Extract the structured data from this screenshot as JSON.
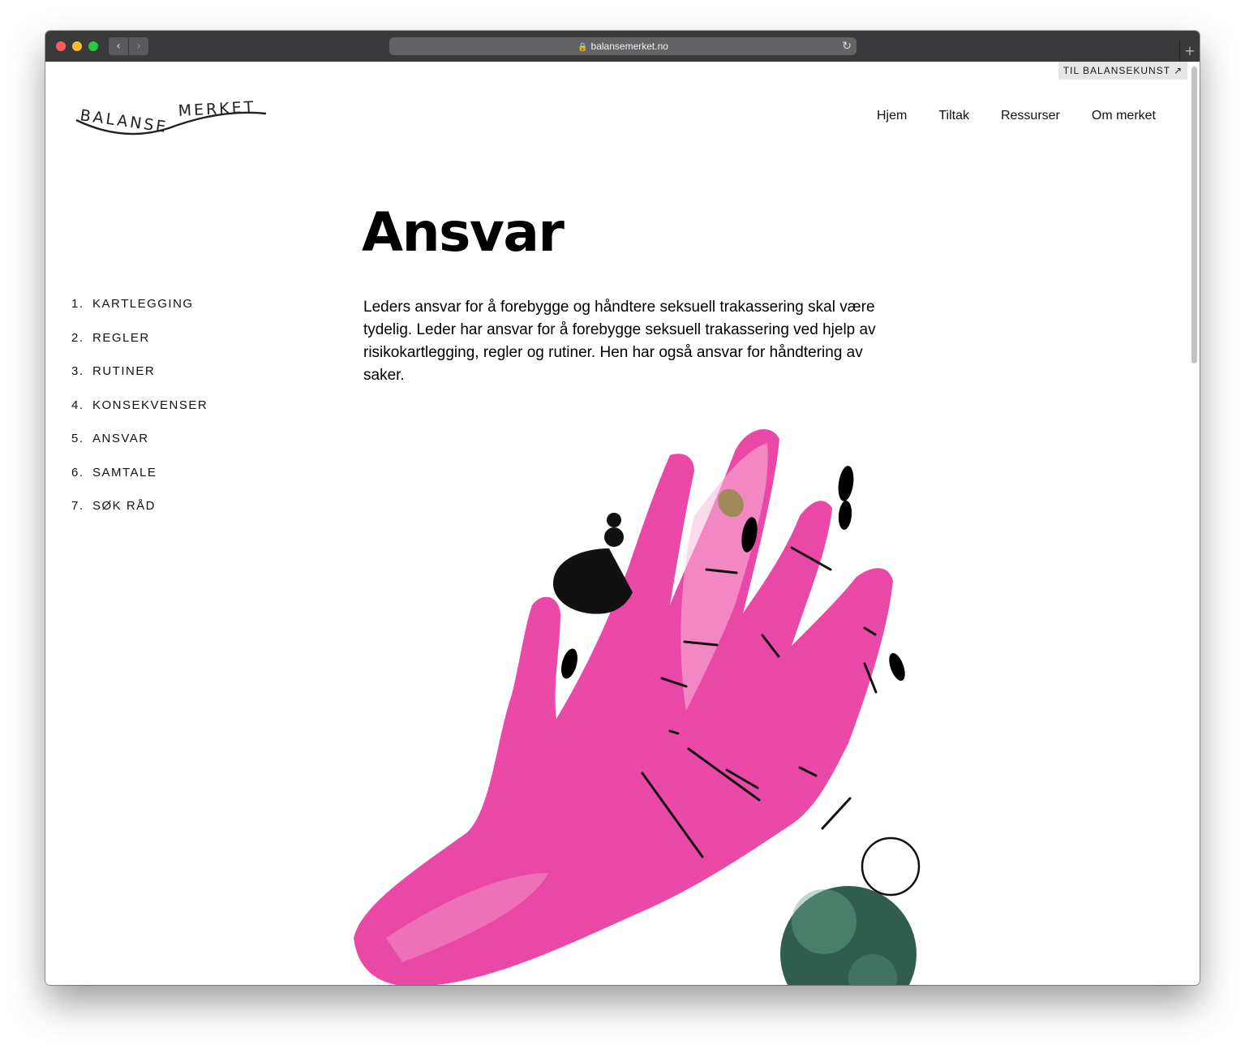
{
  "browser": {
    "url": "balansemerket.no"
  },
  "header": {
    "logo_text_left": "BALANSE",
    "logo_text_right": "MERKET",
    "top_link_label": "TIL BALANSEKUNST ↗",
    "nav": [
      {
        "label": "Hjem"
      },
      {
        "label": "Tiltak"
      },
      {
        "label": "Ressurser"
      },
      {
        "label": "Om merket"
      }
    ]
  },
  "sidebar": {
    "items": [
      {
        "number": "1.",
        "label": "KARTLEGGING"
      },
      {
        "number": "2.",
        "label": "REGLER"
      },
      {
        "number": "3.",
        "label": "RUTINER"
      },
      {
        "number": "4.",
        "label": "KONSEKVENSER"
      },
      {
        "number": "5.",
        "label": "ANSVAR"
      },
      {
        "number": "6.",
        "label": "SAMTALE"
      },
      {
        "number": "7.",
        "label": "SØK RÅD"
      }
    ]
  },
  "main": {
    "title": "Ansvar",
    "intro": "Leders ansvar for å forebygge og håndtere seksuell trakassering skal være tydelig. Leder har ansvar for å forebygge seksuell trakassering ved hjelp av risikokartlegging, regler og rutiner. Hen har også ansvar for håndtering av saker."
  },
  "illustration": {
    "hand_color": "#e8399f",
    "sphere_color": "#2f5d4e",
    "accent_color": "#a08a5a"
  }
}
